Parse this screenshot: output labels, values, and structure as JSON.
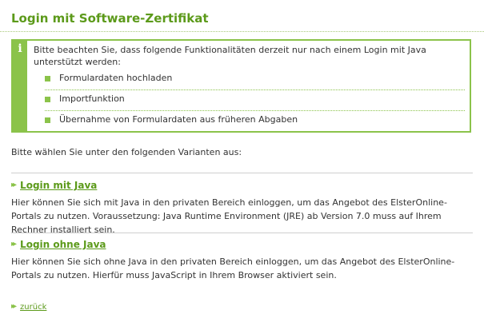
{
  "page": {
    "title": "Login mit Software-Zertifikat"
  },
  "info": {
    "icon": "info-icon",
    "icon_glyph": "i",
    "text": "Bitte beachten Sie, dass folgende Funktionalitäten derzeit nur nach einem Login mit Java unterstützt werden:",
    "items": [
      "Formulardaten hochladen",
      "Importfunktion",
      "Übernahme von Formulardaten aus früheren Abgaben"
    ]
  },
  "choose_text": "Bitte wählen Sie unter den folgenden Varianten aus:",
  "options": [
    {
      "label": "Login mit Java",
      "description": "Hier können Sie sich mit Java in den privaten Bereich einloggen, um das Angebot des ElsterOnline-Portals zu nutzen. Voraussetzung: Java Runtime Environment (JRE) ab Version 7.0 muss auf Ihrem Rechner installiert sein."
    },
    {
      "label": "Login ohne Java",
      "description": "Hier können Sie sich ohne Java in den privaten Bereich einloggen, um das Angebot des ElsterOnline-Portals zu nutzen. Hierfür muss JavaScript in Ihrem Browser aktiviert sein."
    }
  ],
  "back": {
    "label": "zurück"
  },
  "icons": {
    "arrow_glyph": "▸▸",
    "arrow_name": "double-arrow-right-icon"
  },
  "colors": {
    "accent": "#8bc34a",
    "title": "#5c9a1a",
    "text": "#333333",
    "separator": "#cfcfcf"
  }
}
